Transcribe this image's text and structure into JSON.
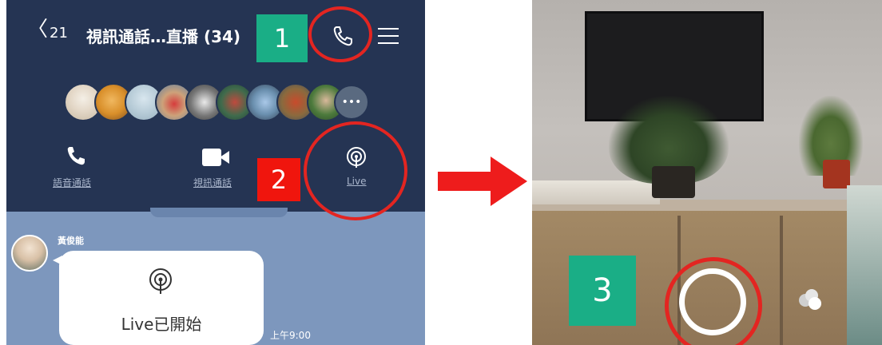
{
  "chat_header": {
    "back_count": "21",
    "title": "視訊通話…直播 (34)",
    "call_icon": "phone-icon",
    "menu_icon": "hamburger-menu-icon"
  },
  "steps": {
    "step1": "1",
    "step2": "2",
    "step3": "3"
  },
  "actions": {
    "voice_call": "語音通話",
    "video_call": "視訊通話",
    "live": "Live"
  },
  "chat": {
    "sender_name": "黃俊能",
    "message": "Live已開始",
    "time": "上午9:00"
  },
  "colors": {
    "header_bg": "#253453",
    "chat_bg": "#7d97bd",
    "step_green": "#1aae86",
    "step_red": "#f0150d",
    "highlight_red": "#e32521"
  }
}
